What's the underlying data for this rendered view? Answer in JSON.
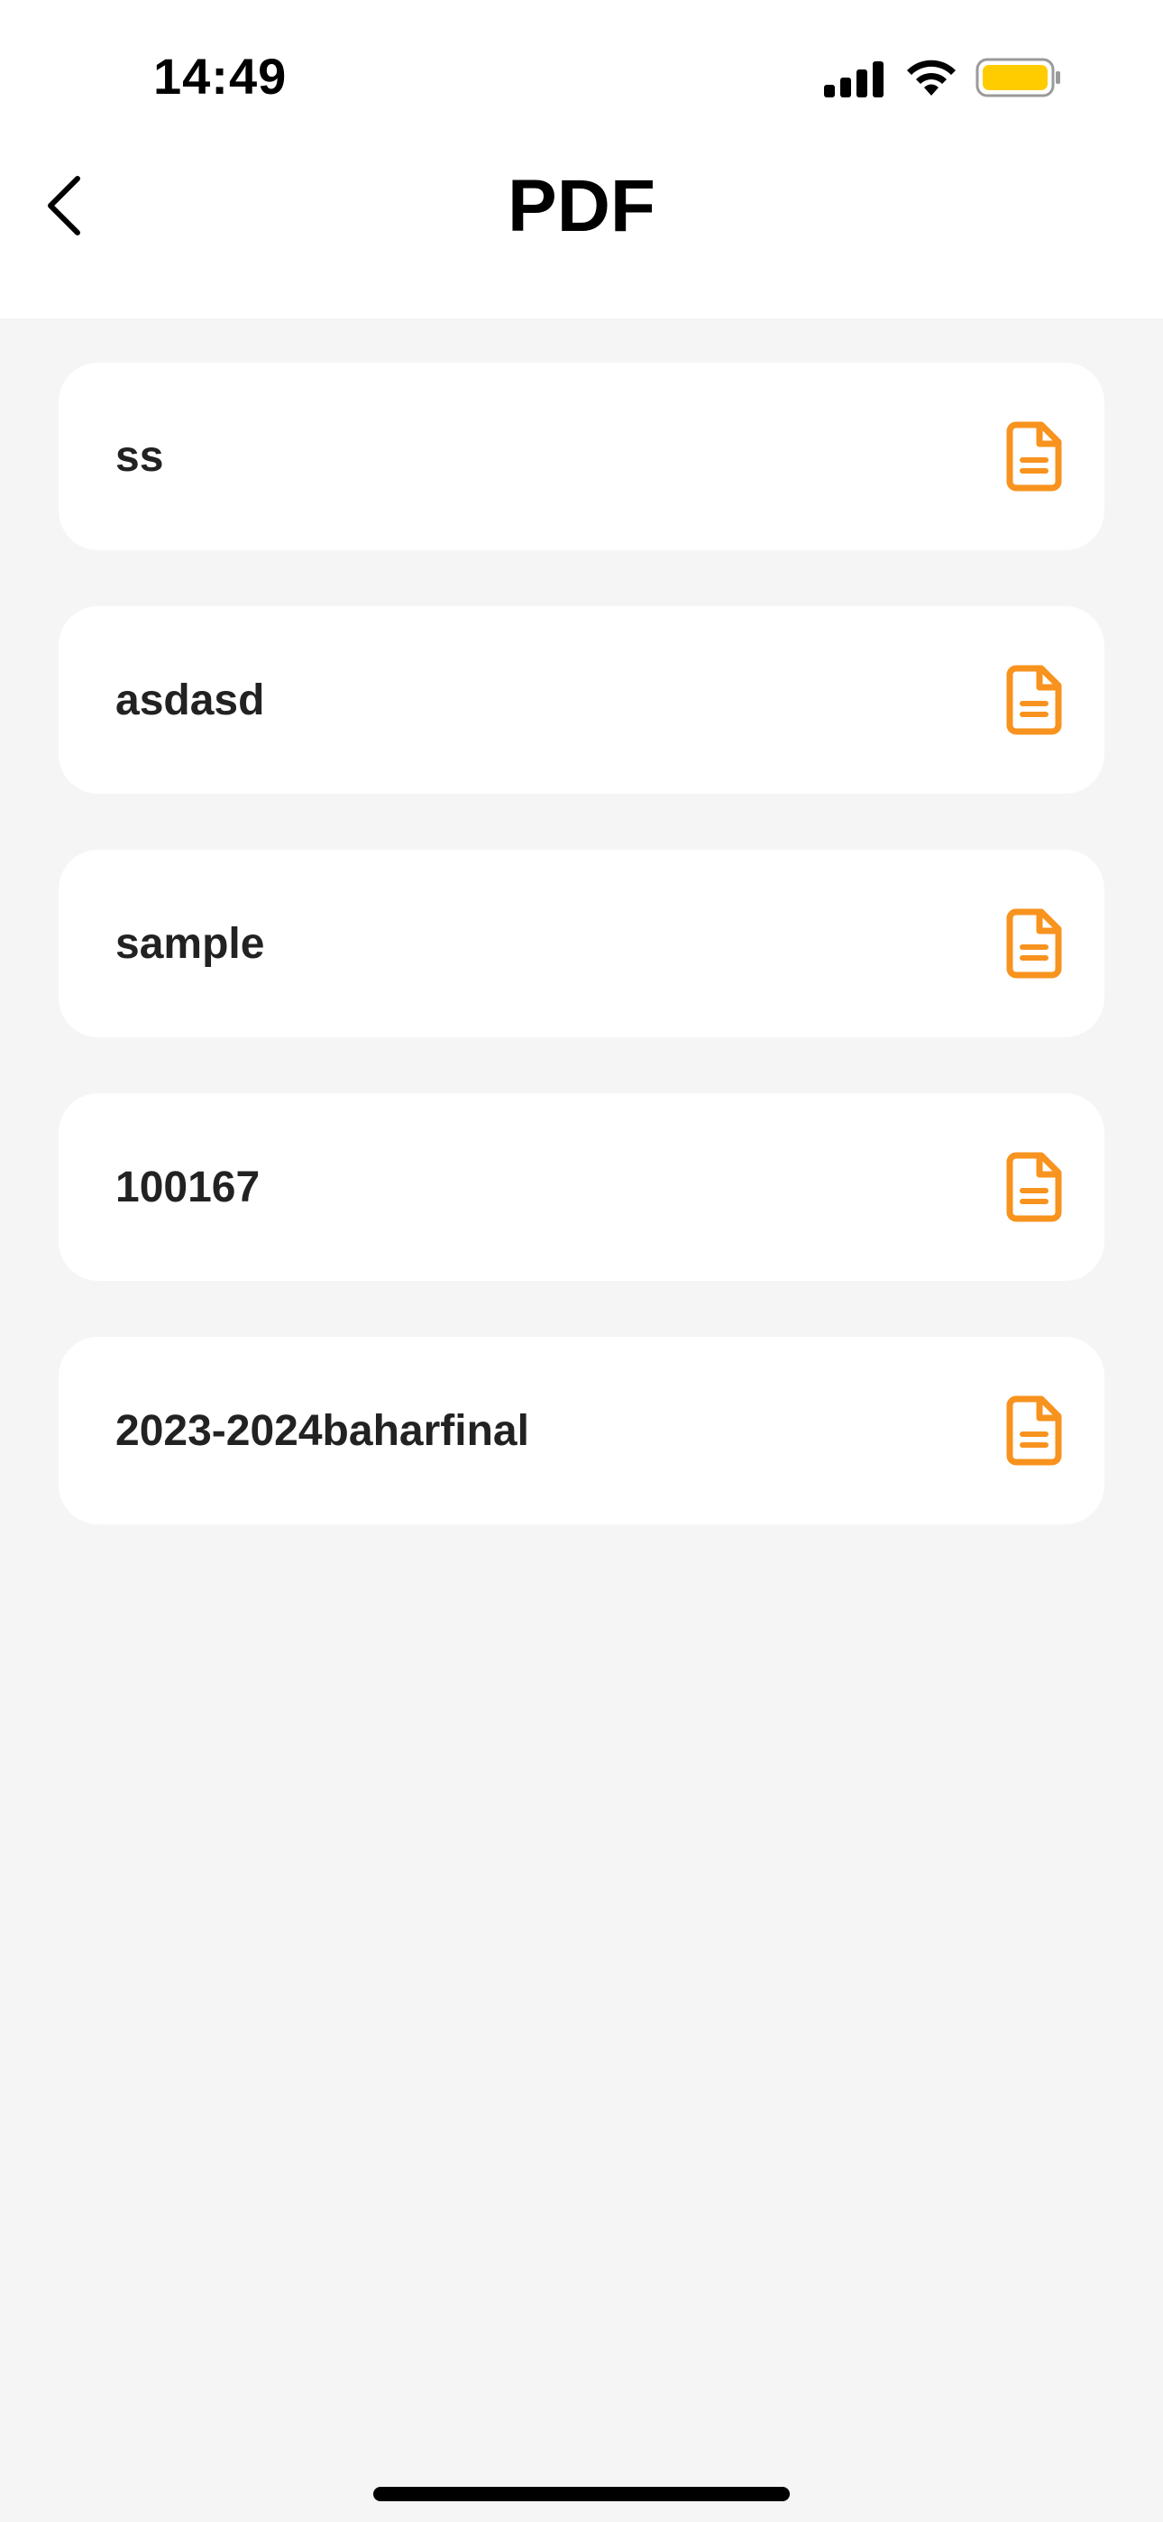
{
  "status_bar": {
    "time": "14:49",
    "icons": [
      "cellular-signal-icon",
      "wifi-icon",
      "battery-icon"
    ],
    "battery_color": "#FFCC00"
  },
  "nav_bar": {
    "back_icon": "chevron-left-icon",
    "title": "PDF"
  },
  "files": [
    {
      "name": "ss",
      "icon": "document-icon"
    },
    {
      "name": "asdasd",
      "icon": "document-icon"
    },
    {
      "name": "sample",
      "icon": "document-icon"
    },
    {
      "name": "100167",
      "icon": "document-icon"
    },
    {
      "name": "2023-2024baharfinal",
      "icon": "document-icon"
    }
  ],
  "colors": {
    "accent": "#F7931E",
    "background": "#F5F5F5",
    "card": "#FFFFFF",
    "text": "#222222"
  }
}
